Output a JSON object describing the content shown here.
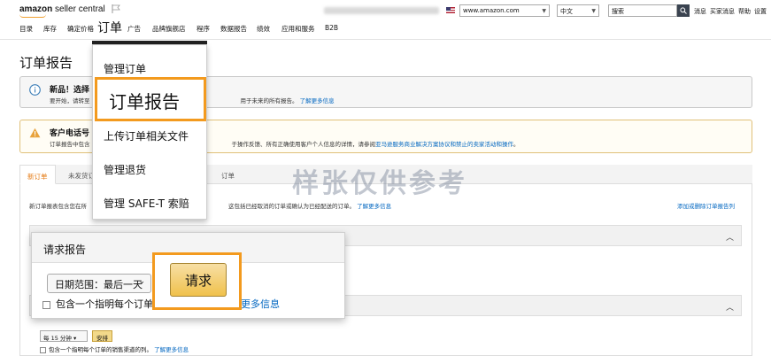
{
  "header": {
    "logo_text_bold": "amazon",
    "logo_text_rest": " seller central",
    "marketplace": "www.amazon.com",
    "language": "中文",
    "search_placeholder": "搜索",
    "links": [
      "消息",
      "买家消息",
      "帮助",
      "设置"
    ]
  },
  "nav": {
    "items": [
      "目录",
      "库存",
      "确定价格",
      "订单",
      "广告",
      "品牌旗舰店",
      "程序",
      "数据报告",
      "绩效",
      "应用和服务",
      "B2B"
    ]
  },
  "page": {
    "title": "订单报告"
  },
  "alerts": {
    "info_title": "新品！选择",
    "info_text": "要开始，请转至",
    "info_text_right": "用于未来的所有报告。",
    "info_link": "了解更多信息",
    "warn_title": "客户电话号",
    "warn_text_left": "订单报告中包含",
    "warn_text_mid": "于操作反馈、所有正确使用客户个人信息的详情，请参阅",
    "warn_link": "亚马逊服务商业解决方案协议和禁止的卖家活动和操作",
    "warn_text_end": "。"
  },
  "tabs": {
    "items": [
      "新订单",
      "未发货订单",
      "订单"
    ]
  },
  "content": {
    "desc_left": "新订单报表包含您在所",
    "desc_mid": "这包括已经取消的订单或确认为已经配送的订单。",
    "desc_link": "了解更多信息",
    "right_link": "添加或删除订单报告列",
    "schedule_value": "每 15 分钟",
    "schedule_button": "安排",
    "schedule_checkbox": "包含一个指明每个订单的销售渠道的列。",
    "schedule_link": "了解更多信息"
  },
  "watermark": "样张仅供参考",
  "menu": {
    "tab_label": "订单",
    "items": [
      "管理订单",
      "订单报告",
      "上传订单相关文件",
      "管理退货",
      "管理 SAFE-T 索赔"
    ]
  },
  "request_card": {
    "title": "请求报告",
    "range_label": "日期范围：最后一天",
    "checkbox_label": "包含一个指明每个订单的",
    "link": "更多信息",
    "button": "请求"
  },
  "colors": {
    "highlight": "#f39a1e",
    "button": "#f0c14b",
    "link": "#0066c0",
    "active_tab": "#e47911"
  }
}
